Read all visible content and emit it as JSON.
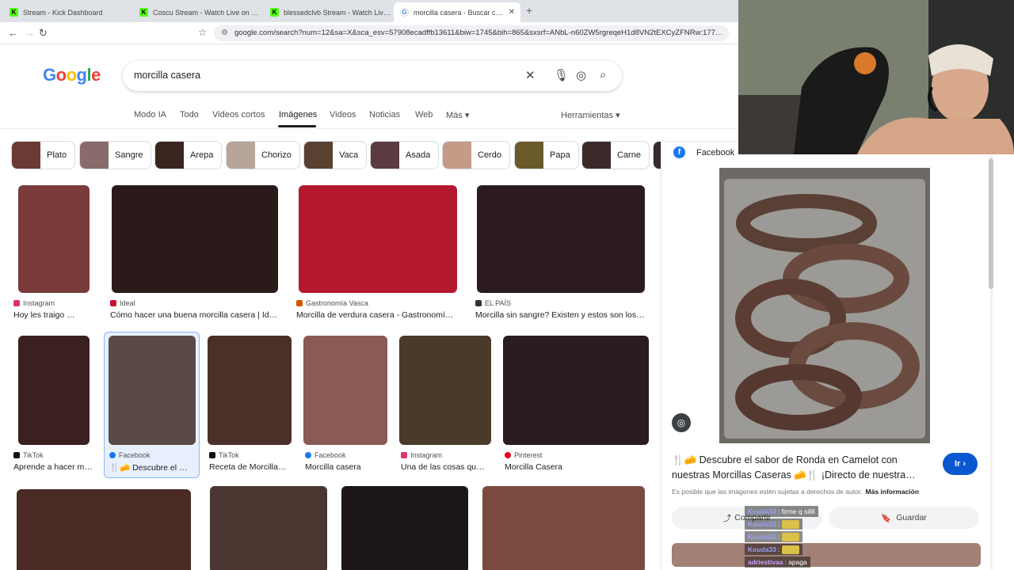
{
  "browser": {
    "tabs": [
      {
        "title": "Stream - Kick Dashboard",
        "icon": "kick-icon",
        "active": false
      },
      {
        "title": "Coscu Stream - Watch Live on Kick",
        "icon": "kick-icon",
        "active": false
      },
      {
        "title": "blessedclvb Stream - Watch Live on Kick",
        "icon": "kick-icon",
        "active": false
      },
      {
        "title": "morcilla casera - Buscar con Google",
        "icon": "google-icon",
        "active": true
      }
    ],
    "url": "google.com/search?num=12&sa=X&sca_esv=57908ecadffb13611&biw=1745&bih=865&sxsrf=ANbL-n60ZW5rgreqeH1d8VN2tEXCyZFNRw:177…"
  },
  "google": {
    "logo": "Google",
    "query": "morcilla casera",
    "filters": [
      "Modo IA",
      "Todo",
      "Videos cortos",
      "Imágenes",
      "Videos",
      "Noticias",
      "Web",
      "Más ▾",
      "Herramientas ▾"
    ],
    "active_filter": "Imágenes",
    "chips": [
      {
        "label": "Plato",
        "color": "#6b3a33"
      },
      {
        "label": "Sangre",
        "color": "#8a6b6b"
      },
      {
        "label": "Arepa",
        "color": "#3a2420"
      },
      {
        "label": "Chorizo",
        "color": "#b7a49a"
      },
      {
        "label": "Vaca",
        "color": "#5a4030"
      },
      {
        "label": "Asada",
        "color": "#5b3a40"
      },
      {
        "label": "Cerdo",
        "color": "#c39b86"
      },
      {
        "label": "Papa",
        "color": "#6a5a2a"
      },
      {
        "label": "Carne",
        "color": "#3b2a2a"
      }
    ]
  },
  "results": [
    {
      "source": "Instagram",
      "title": "Hoy les traigo …",
      "icon_color": "#e1306c",
      "img_color": "#7a3b3b"
    },
    {
      "source": "Ideal",
      "title": "Cómo hacer una buena morcilla casera | Id…",
      "icon_color": "#c8102e",
      "img_color": "#2a1a1a"
    },
    {
      "source": "Gastronomía Vasca",
      "title": "Morcilla de verdura casera - Gastronomí…",
      "icon_color": "#d35400",
      "img_color": "#b3182f"
    },
    {
      "source": "EL PAÍS",
      "title": "Morcilla sin sangre? Existen y estos son los…",
      "icon_color": "#333333",
      "img_color": "#2b1b1f"
    },
    {
      "source": "TikTok",
      "title": "Aprende a hacer m…",
      "icon_color": "#111111",
      "img_color": "#3a2020"
    },
    {
      "source": "Facebook",
      "title": "🍴🧀 Descubre el …",
      "icon_color": "#1877f2",
      "img_color": "#5a4a45"
    },
    {
      "source": "TikTok",
      "title": "Receta de Morcilla…",
      "icon_color": "#111111",
      "img_color": "#4a3028"
    },
    {
      "source": "Facebook",
      "title": "Morcilla casera",
      "icon_color": "#1877f2",
      "img_color": "#8a5a55"
    },
    {
      "source": "Instagram",
      "title": "Una de las cosas qu…",
      "icon_color": "#e1306c",
      "img_color": "#4a3a2a"
    },
    {
      "source": "Pinterest",
      "title": "Morcilla Casera",
      "icon_color": "#e60023",
      "img_color": "#2a1c20"
    },
    {
      "source": "",
      "title": "",
      "icon_color": "#ffffff",
      "img_color": "#4a2a25"
    },
    {
      "source": "",
      "title": "",
      "icon_color": "#ffffff",
      "img_color": "#4a3530"
    },
    {
      "source": "",
      "title": "",
      "icon_color": "#ffffff",
      "img_color": "#1c1616"
    },
    {
      "source": "",
      "title": "",
      "icon_color": "#ffffff",
      "img_color": "#7a4a3f"
    }
  ],
  "panel": {
    "source": "Facebook",
    "description": "🍴🧀 Descubre el sabor de Ronda en Camelot con nuestras Morcillas Caseras 🧀🍴 ¡Directo de nuestra…",
    "go_label": "Ir ›",
    "note": "Es posible que las imágenes estén sujetas a derechos de autor.",
    "more_info": "Más información",
    "share_label": "Compartir",
    "save_label": "Guardar"
  },
  "chat": [
    {
      "user": "Kouda33",
      "message": ": firme q sillll",
      "emote": false
    },
    {
      "user": "Kouda33",
      "message": ":",
      "emote": true
    },
    {
      "user": "Kouda33",
      "message": ":",
      "emote": true
    },
    {
      "user": "Kouda33",
      "message": ":",
      "emote": true
    },
    {
      "user": "adriestivaa",
      "message": ": apaga",
      "emote": false
    }
  ]
}
